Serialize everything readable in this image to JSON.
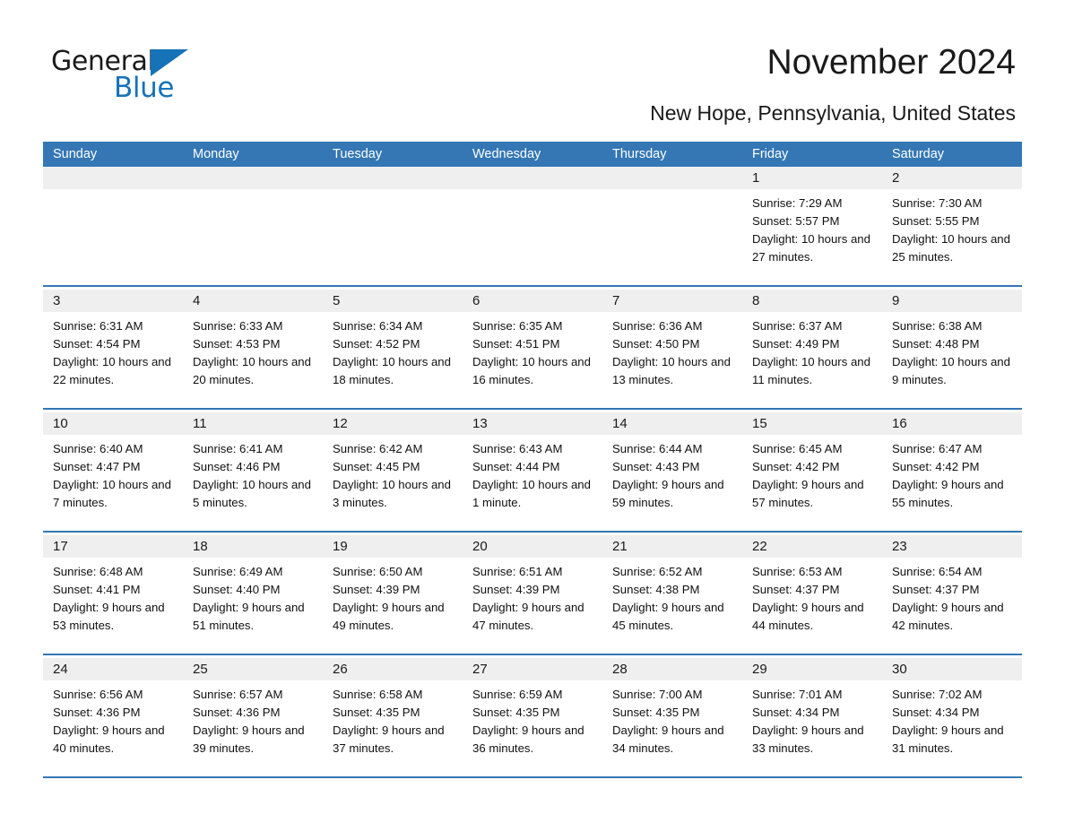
{
  "brand": {
    "name_part1": "General",
    "name_part2": "Blue",
    "logo_icon": "blue-triangle",
    "accent_color": "#1673b8"
  },
  "header": {
    "title": "November 2024",
    "subtitle": "New Hope, Pennsylvania, United States"
  },
  "calendar": {
    "header_bg": "#3477b4",
    "day_header_bg": "#efefef",
    "weekdays": [
      "Sunday",
      "Monday",
      "Tuesday",
      "Wednesday",
      "Thursday",
      "Friday",
      "Saturday"
    ],
    "weeks": [
      [
        {
          "day": "",
          "sunrise": "",
          "sunset": "",
          "daylight": ""
        },
        {
          "day": "",
          "sunrise": "",
          "sunset": "",
          "daylight": ""
        },
        {
          "day": "",
          "sunrise": "",
          "sunset": "",
          "daylight": ""
        },
        {
          "day": "",
          "sunrise": "",
          "sunset": "",
          "daylight": ""
        },
        {
          "day": "",
          "sunrise": "",
          "sunset": "",
          "daylight": ""
        },
        {
          "day": "1",
          "sunrise": "Sunrise: 7:29 AM",
          "sunset": "Sunset: 5:57 PM",
          "daylight": "Daylight: 10 hours and 27 minutes."
        },
        {
          "day": "2",
          "sunrise": "Sunrise: 7:30 AM",
          "sunset": "Sunset: 5:55 PM",
          "daylight": "Daylight: 10 hours and 25 minutes."
        }
      ],
      [
        {
          "day": "3",
          "sunrise": "Sunrise: 6:31 AM",
          "sunset": "Sunset: 4:54 PM",
          "daylight": "Daylight: 10 hours and 22 minutes."
        },
        {
          "day": "4",
          "sunrise": "Sunrise: 6:33 AM",
          "sunset": "Sunset: 4:53 PM",
          "daylight": "Daylight: 10 hours and 20 minutes."
        },
        {
          "day": "5",
          "sunrise": "Sunrise: 6:34 AM",
          "sunset": "Sunset: 4:52 PM",
          "daylight": "Daylight: 10 hours and 18 minutes."
        },
        {
          "day": "6",
          "sunrise": "Sunrise: 6:35 AM",
          "sunset": "Sunset: 4:51 PM",
          "daylight": "Daylight: 10 hours and 16 minutes."
        },
        {
          "day": "7",
          "sunrise": "Sunrise: 6:36 AM",
          "sunset": "Sunset: 4:50 PM",
          "daylight": "Daylight: 10 hours and 13 minutes."
        },
        {
          "day": "8",
          "sunrise": "Sunrise: 6:37 AM",
          "sunset": "Sunset: 4:49 PM",
          "daylight": "Daylight: 10 hours and 11 minutes."
        },
        {
          "day": "9",
          "sunrise": "Sunrise: 6:38 AM",
          "sunset": "Sunset: 4:48 PM",
          "daylight": "Daylight: 10 hours and 9 minutes."
        }
      ],
      [
        {
          "day": "10",
          "sunrise": "Sunrise: 6:40 AM",
          "sunset": "Sunset: 4:47 PM",
          "daylight": "Daylight: 10 hours and 7 minutes."
        },
        {
          "day": "11",
          "sunrise": "Sunrise: 6:41 AM",
          "sunset": "Sunset: 4:46 PM",
          "daylight": "Daylight: 10 hours and 5 minutes."
        },
        {
          "day": "12",
          "sunrise": "Sunrise: 6:42 AM",
          "sunset": "Sunset: 4:45 PM",
          "daylight": "Daylight: 10 hours and 3 minutes."
        },
        {
          "day": "13",
          "sunrise": "Sunrise: 6:43 AM",
          "sunset": "Sunset: 4:44 PM",
          "daylight": "Daylight: 10 hours and 1 minute."
        },
        {
          "day": "14",
          "sunrise": "Sunrise: 6:44 AM",
          "sunset": "Sunset: 4:43 PM",
          "daylight": "Daylight: 9 hours and 59 minutes."
        },
        {
          "day": "15",
          "sunrise": "Sunrise: 6:45 AM",
          "sunset": "Sunset: 4:42 PM",
          "daylight": "Daylight: 9 hours and 57 minutes."
        },
        {
          "day": "16",
          "sunrise": "Sunrise: 6:47 AM",
          "sunset": "Sunset: 4:42 PM",
          "daylight": "Daylight: 9 hours and 55 minutes."
        }
      ],
      [
        {
          "day": "17",
          "sunrise": "Sunrise: 6:48 AM",
          "sunset": "Sunset: 4:41 PM",
          "daylight": "Daylight: 9 hours and 53 minutes."
        },
        {
          "day": "18",
          "sunrise": "Sunrise: 6:49 AM",
          "sunset": "Sunset: 4:40 PM",
          "daylight": "Daylight: 9 hours and 51 minutes."
        },
        {
          "day": "19",
          "sunrise": "Sunrise: 6:50 AM",
          "sunset": "Sunset: 4:39 PM",
          "daylight": "Daylight: 9 hours and 49 minutes."
        },
        {
          "day": "20",
          "sunrise": "Sunrise: 6:51 AM",
          "sunset": "Sunset: 4:39 PM",
          "daylight": "Daylight: 9 hours and 47 minutes."
        },
        {
          "day": "21",
          "sunrise": "Sunrise: 6:52 AM",
          "sunset": "Sunset: 4:38 PM",
          "daylight": "Daylight: 9 hours and 45 minutes."
        },
        {
          "day": "22",
          "sunrise": "Sunrise: 6:53 AM",
          "sunset": "Sunset: 4:37 PM",
          "daylight": "Daylight: 9 hours and 44 minutes."
        },
        {
          "day": "23",
          "sunrise": "Sunrise: 6:54 AM",
          "sunset": "Sunset: 4:37 PM",
          "daylight": "Daylight: 9 hours and 42 minutes."
        }
      ],
      [
        {
          "day": "24",
          "sunrise": "Sunrise: 6:56 AM",
          "sunset": "Sunset: 4:36 PM",
          "daylight": "Daylight: 9 hours and 40 minutes."
        },
        {
          "day": "25",
          "sunrise": "Sunrise: 6:57 AM",
          "sunset": "Sunset: 4:36 PM",
          "daylight": "Daylight: 9 hours and 39 minutes."
        },
        {
          "day": "26",
          "sunrise": "Sunrise: 6:58 AM",
          "sunset": "Sunset: 4:35 PM",
          "daylight": "Daylight: 9 hours and 37 minutes."
        },
        {
          "day": "27",
          "sunrise": "Sunrise: 6:59 AM",
          "sunset": "Sunset: 4:35 PM",
          "daylight": "Daylight: 9 hours and 36 minutes."
        },
        {
          "day": "28",
          "sunrise": "Sunrise: 7:00 AM",
          "sunset": "Sunset: 4:35 PM",
          "daylight": "Daylight: 9 hours and 34 minutes."
        },
        {
          "day": "29",
          "sunrise": "Sunrise: 7:01 AM",
          "sunset": "Sunset: 4:34 PM",
          "daylight": "Daylight: 9 hours and 33 minutes."
        },
        {
          "day": "30",
          "sunrise": "Sunrise: 7:02 AM",
          "sunset": "Sunset: 4:34 PM",
          "daylight": "Daylight: 9 hours and 31 minutes."
        }
      ]
    ]
  }
}
